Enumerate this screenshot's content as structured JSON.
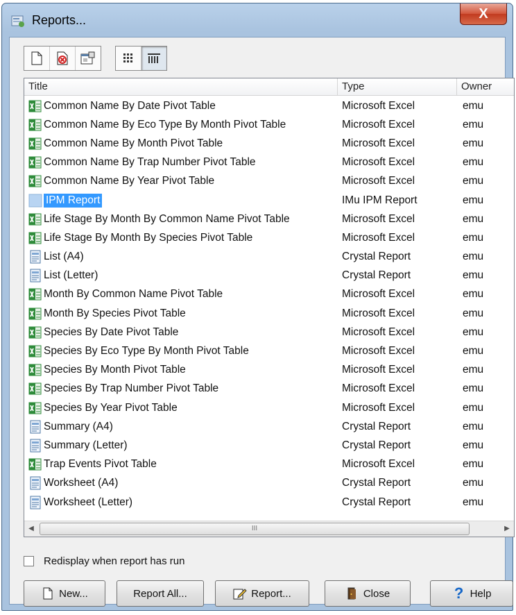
{
  "window": {
    "title": "Reports...",
    "close_label": "X"
  },
  "toolbar": {
    "buttons": [
      "new-report-icon",
      "delete-report-icon",
      "properties-icon",
      "list-view-icon",
      "details-view-icon"
    ]
  },
  "list": {
    "columns": [
      "Title",
      "Type",
      "Owner"
    ],
    "rows": [
      {
        "title": "Common Name By Date Pivot Table",
        "type": "Microsoft Excel",
        "owner": "emu",
        "icon": "excel-icon"
      },
      {
        "title": "Common Name By Eco Type By Month Pivot Table",
        "type": "Microsoft Excel",
        "owner": "emu",
        "icon": "excel-icon"
      },
      {
        "title": "Common Name By Month Pivot Table",
        "type": "Microsoft Excel",
        "owner": "emu",
        "icon": "excel-icon"
      },
      {
        "title": "Common Name By Trap Number Pivot Table",
        "type": "Microsoft Excel",
        "owner": "emu",
        "icon": "excel-icon"
      },
      {
        "title": "Common Name By Year Pivot Table",
        "type": "Microsoft Excel",
        "owner": "emu",
        "icon": "excel-icon"
      },
      {
        "title": "IPM Report",
        "type": "IMu IPM Report",
        "owner": "emu",
        "icon": "ipm-report-icon",
        "selected": true
      },
      {
        "title": "Life Stage By Month By Common Name Pivot Table",
        "type": "Microsoft Excel",
        "owner": "emu",
        "icon": "excel-icon"
      },
      {
        "title": "Life Stage By Month By Species Pivot Table",
        "type": "Microsoft Excel",
        "owner": "emu",
        "icon": "excel-icon"
      },
      {
        "title": "List (A4)",
        "type": "Crystal Report",
        "owner": "emu",
        "icon": "crystal-report-icon"
      },
      {
        "title": "List (Letter)",
        "type": "Crystal Report",
        "owner": "emu",
        "icon": "crystal-report-icon"
      },
      {
        "title": "Month By Common Name Pivot Table",
        "type": "Microsoft Excel",
        "owner": "emu",
        "icon": "excel-icon"
      },
      {
        "title": "Month By Species Pivot Table",
        "type": "Microsoft Excel",
        "owner": "emu",
        "icon": "excel-icon"
      },
      {
        "title": "Species By Date Pivot Table",
        "type": "Microsoft Excel",
        "owner": "emu",
        "icon": "excel-icon"
      },
      {
        "title": "Species By Eco Type By Month Pivot Table",
        "type": "Microsoft Excel",
        "owner": "emu",
        "icon": "excel-icon"
      },
      {
        "title": "Species By Month Pivot Table",
        "type": "Microsoft Excel",
        "owner": "emu",
        "icon": "excel-icon"
      },
      {
        "title": "Species By Trap Number Pivot Table",
        "type": "Microsoft Excel",
        "owner": "emu",
        "icon": "excel-icon"
      },
      {
        "title": "Species By Year Pivot Table",
        "type": "Microsoft Excel",
        "owner": "emu",
        "icon": "excel-icon"
      },
      {
        "title": "Summary (A4)",
        "type": "Crystal Report",
        "owner": "emu",
        "icon": "crystal-report-icon"
      },
      {
        "title": "Summary (Letter)",
        "type": "Crystal Report",
        "owner": "emu",
        "icon": "crystal-report-icon"
      },
      {
        "title": "Trap Events Pivot Table",
        "type": "Microsoft Excel",
        "owner": "emu",
        "icon": "excel-icon"
      },
      {
        "title": "Worksheet (A4)",
        "type": "Crystal Report",
        "owner": "emu",
        "icon": "crystal-report-icon"
      },
      {
        "title": "Worksheet (Letter)",
        "type": "Crystal Report",
        "owner": "emu",
        "icon": "crystal-report-icon"
      }
    ]
  },
  "scrollbar": {
    "thumb_grip": "III"
  },
  "options": {
    "redisplay_label": "Redisplay when report has run",
    "redisplay_checked": false
  },
  "buttons": {
    "new": "New...",
    "report_all": "Report All...",
    "report": "Report...",
    "close": "Close",
    "help": "Help"
  },
  "colors": {
    "selection": "#3399ff",
    "excel_green": "#2e8b3a",
    "title_bar": "#b9d1ea"
  }
}
